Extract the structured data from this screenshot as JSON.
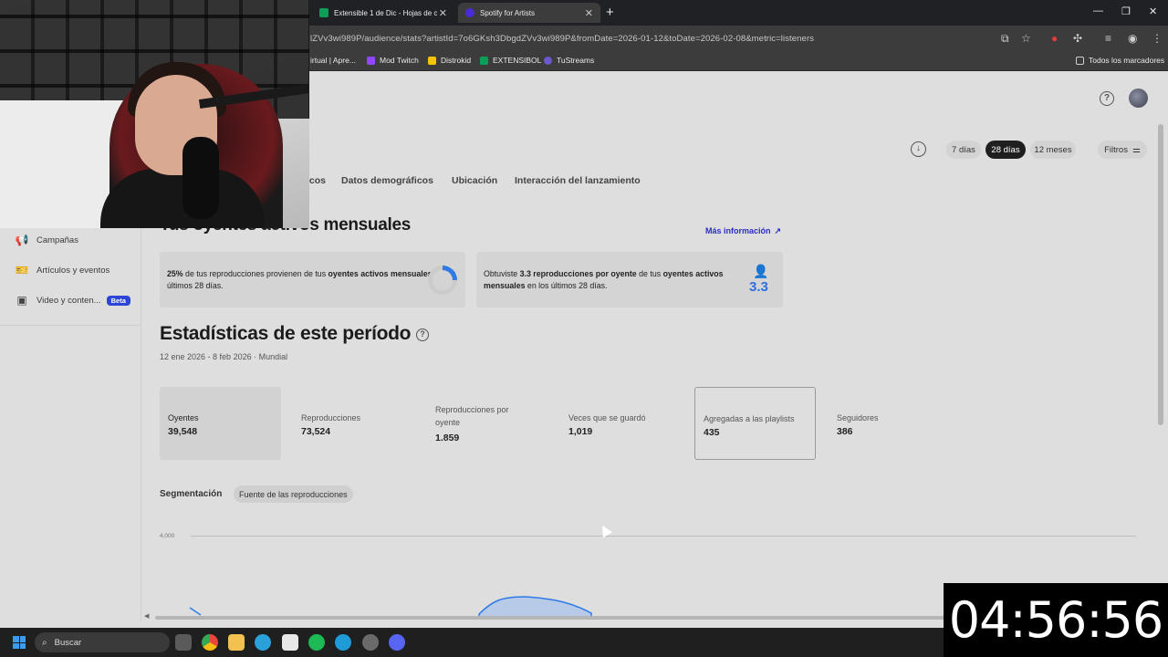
{
  "browser": {
    "tabs": [
      {
        "label": "Extensible 1 de Dic - Hojas de c",
        "color": "#0f9d58"
      },
      {
        "label": "Spotify for Artists",
        "color": "#4b2bd6"
      }
    ],
    "url": "lZVv3wi989P/audience/stats?artistId=7o6GKsh3DbgdZVv3wi989P&fromDate=2026-01-12&toDate=2026-02-08&metric=listeners",
    "bookmarks": [
      {
        "label": "irtual | Apre...",
        "color": "#bbbbbb"
      },
      {
        "label": "Mod Twitch",
        "color": "#9146ff"
      },
      {
        "label": "Distrokid",
        "color": "#f5c400"
      },
      {
        "label": "EXTENSIBOL",
        "color": "#0f9d58"
      },
      {
        "label": "TuStreams",
        "color": "#6a5acd"
      }
    ],
    "all_bookmarks": "Todos los marcadores"
  },
  "sidebar": {
    "items": [
      {
        "label": "Campañas",
        "icon": "megaphone-icon"
      },
      {
        "label": "Artículos y eventos",
        "icon": "ticket-icon"
      },
      {
        "label": "Video y conten...",
        "icon": "video-icon",
        "badge": "Beta"
      }
    ]
  },
  "filters": {
    "ranges": [
      "7 días",
      "28 días",
      "12 meses"
    ],
    "selected_range": "28 días",
    "filters_label": "Filtros"
  },
  "subnav": {
    "items": [
      "icos",
      "Datos demográficos",
      "Ubicación",
      "Interacción del lanzamiento"
    ]
  },
  "listeners": {
    "title": "Tus oyentes activos mensuales",
    "more_info": "Más información",
    "card1": {
      "pct": "25%",
      "text1": " de tus reproducciones provienen de tus ",
      "bold1": "oyentes activos mensuales",
      "text2": " en los últimos 28 días.",
      "fraction": 0.25
    },
    "card2": {
      "text0": "Obtuviste ",
      "bold0": "3.3 reproducciones por oyente",
      "text1": " de tus ",
      "bold1": "oyentes activos mensuales",
      "text2": " en los últimos 28 días.",
      "stat": "3.3"
    }
  },
  "stats": {
    "title": "Estadísticas de este período",
    "date_range": "12 ene 2026 - 8 feb 2026 · Mundial",
    "metrics": [
      {
        "label": "Oyentes",
        "value": "39,548"
      },
      {
        "label": "Reproducciones",
        "value": "73,524"
      },
      {
        "label": "Reproducciones por oyente",
        "value": "1.859"
      },
      {
        "label": "Veces que se guardó",
        "value": "1,019"
      },
      {
        "label": "Agregadas a las playlists",
        "value": "435"
      },
      {
        "label": "Seguidores",
        "value": "386"
      }
    ],
    "segmentation_label": "Segmentación",
    "segmentation_option": "Fuente de las reproducciones",
    "chart_tick": "4,000"
  },
  "taskbar": {
    "search_label": "Buscar",
    "apps": [
      {
        "name": "taskview",
        "color": "#5a5a5a"
      },
      {
        "name": "chrome",
        "color": "#e8453c"
      },
      {
        "name": "files",
        "color": "#f2c14e"
      },
      {
        "name": "telegram",
        "color": "#2aa1da"
      },
      {
        "name": "capcut",
        "color": "#e8e8e8"
      },
      {
        "name": "spotify",
        "color": "#1db954"
      },
      {
        "name": "edge",
        "color": "#1f9bd8"
      },
      {
        "name": "obs",
        "color": "#6a6a6a"
      },
      {
        "name": "discord",
        "color": "#5865f2"
      }
    ]
  },
  "timer": "04:56:56"
}
